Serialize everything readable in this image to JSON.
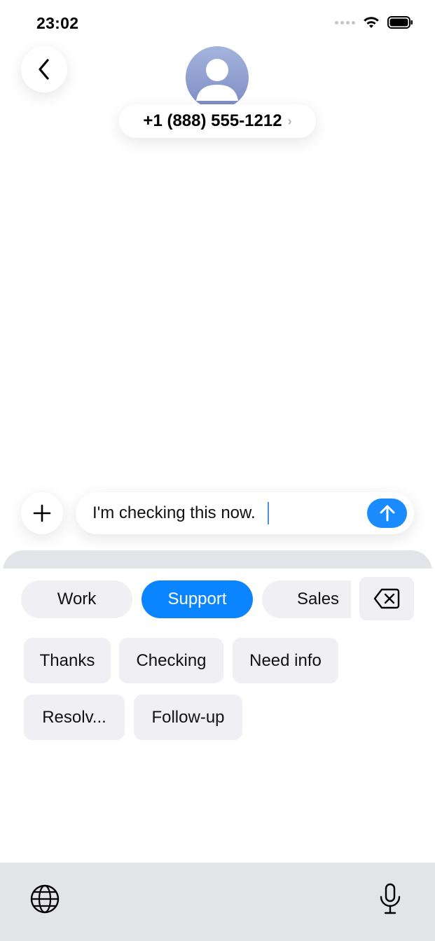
{
  "status_bar": {
    "time": "23:02"
  },
  "header": {
    "contact": "+1 (888) 555-1212",
    "chevron": "›"
  },
  "compose": {
    "message": "I'm checking this now."
  },
  "keyboard": {
    "categories": [
      {
        "label": "Work",
        "active": false
      },
      {
        "label": "Support",
        "active": true
      },
      {
        "label": "Sales",
        "active": false
      }
    ],
    "phrases": [
      "Thanks",
      "Checking",
      "Need info",
      "Resolv...",
      "Follow-up"
    ]
  },
  "icons": {
    "back": "chevron-left-icon",
    "avatar": "person-icon",
    "add": "plus-icon",
    "send": "arrow-up-icon",
    "delete": "delete-backspace-icon",
    "globe": "globe-icon",
    "mic": "microphone-icon",
    "wifi": "wifi-icon",
    "battery": "battery-icon"
  },
  "colors": {
    "accent": "#0a84ff",
    "send": "#1a8cff",
    "keyboard_bg": "#e3e4e8",
    "chip_bg": "#f0f0f4"
  }
}
